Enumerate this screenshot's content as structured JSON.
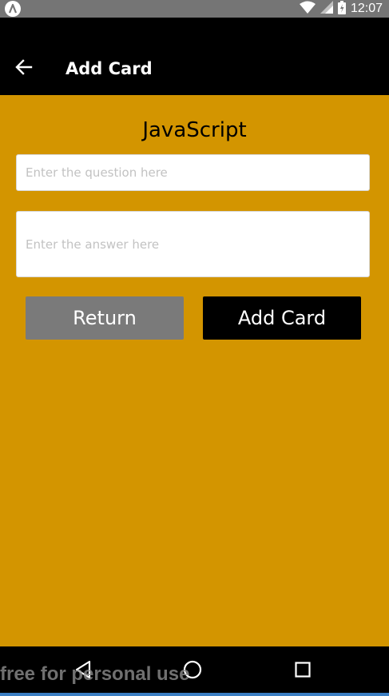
{
  "status_bar": {
    "time": "12:07",
    "icons": [
      "app-notification-icon",
      "wifi-icon",
      "signal-icon",
      "battery-icon"
    ]
  },
  "app_bar": {
    "back_icon": "arrow-left-icon",
    "title": "Add Card"
  },
  "form": {
    "deck_title": "JavaScript",
    "question": {
      "value": "",
      "placeholder": "Enter the question here"
    },
    "answer": {
      "value": "",
      "placeholder": "Enter the answer here"
    },
    "return_label": "Return",
    "add_card_label": "Add Card"
  },
  "nav_bar": {
    "icons": [
      "nav-back-icon",
      "nav-home-icon",
      "nav-recents-icon"
    ]
  },
  "watermark": "free for personal use",
  "colors": {
    "status_bar": "#757575",
    "app_bar": "#000000",
    "background": "#D39500",
    "return_button": "#7a7a7a",
    "add_card_button": "#000000"
  }
}
